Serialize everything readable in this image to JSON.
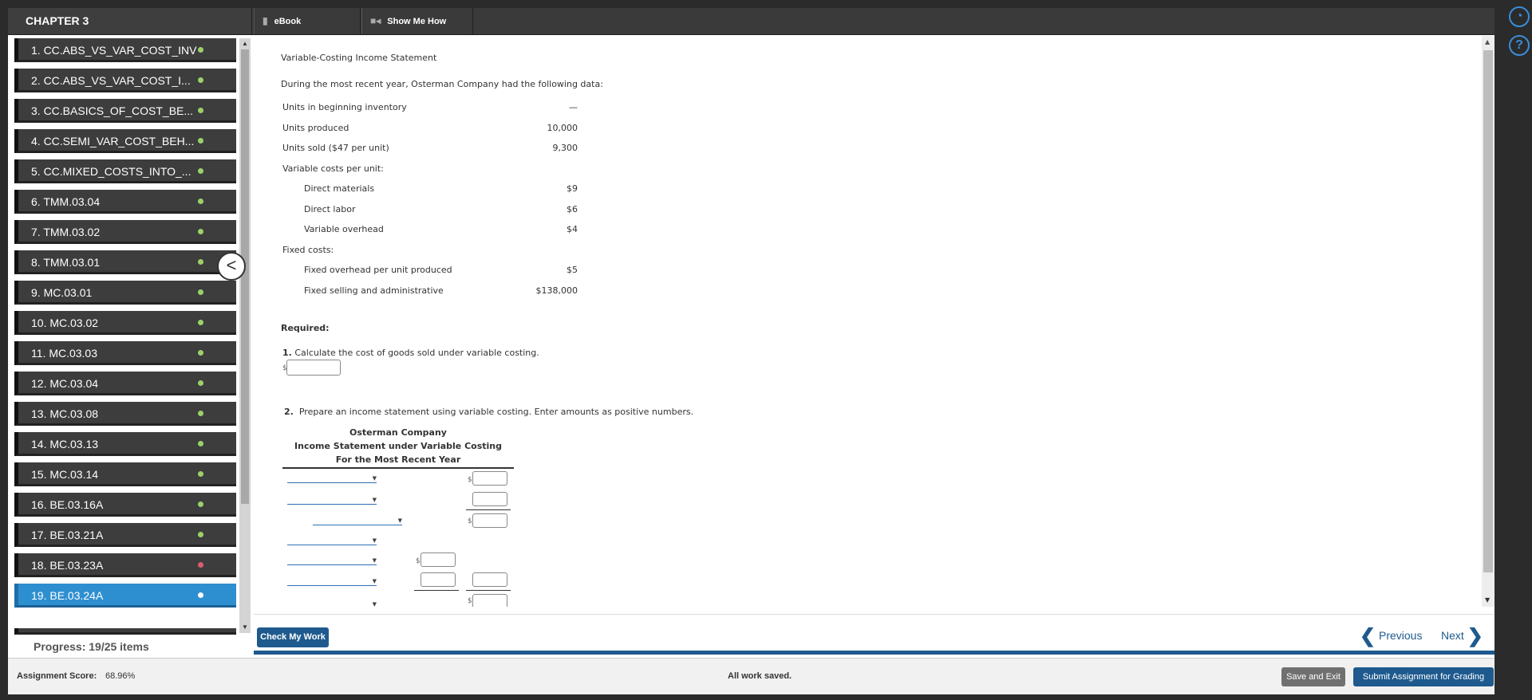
{
  "header": {
    "chapter": "CHAPTER 3",
    "tabs": [
      {
        "label": "eBook",
        "icon": "book-icon"
      },
      {
        "label": "Show Me How",
        "icon": "video-icon"
      }
    ]
  },
  "sidebar": {
    "items": [
      {
        "label": "1. CC.ABS_VS_VAR_COST_INV",
        "status": "done"
      },
      {
        "label": "2. CC.ABS_VS_VAR_COST_I...",
        "status": "done"
      },
      {
        "label": "3. CC.BASICS_OF_COST_BE...",
        "status": "done"
      },
      {
        "label": "4. CC.SEMI_VAR_COST_BEH...",
        "status": "done"
      },
      {
        "label": "5. CC.MIXED_COSTS_INTO_...",
        "status": "done"
      },
      {
        "label": "6. TMM.03.04",
        "status": "done"
      },
      {
        "label": "7. TMM.03.02",
        "status": "done"
      },
      {
        "label": "8. TMM.03.01",
        "status": "done"
      },
      {
        "label": "9. MC.03.01",
        "status": "done"
      },
      {
        "label": "10. MC.03.02",
        "status": "done"
      },
      {
        "label": "11. MC.03.03",
        "status": "done"
      },
      {
        "label": "12. MC.03.04",
        "status": "done"
      },
      {
        "label": "13. MC.03.08",
        "status": "done"
      },
      {
        "label": "14. MC.03.13",
        "status": "done"
      },
      {
        "label": "15. MC.03.14",
        "status": "done"
      },
      {
        "label": "16. BE.03.16A",
        "status": "done"
      },
      {
        "label": "17. BE.03.21A",
        "status": "done"
      },
      {
        "label": "18. BE.03.23A",
        "status": "wrong"
      },
      {
        "label": "19. BE.03.24A",
        "status": "current"
      }
    ],
    "progress": "Progress:  19/25 items"
  },
  "problem": {
    "title": "Variable-Costing Income Statement",
    "intro": "During the most recent year, Osterman Company had the following data:",
    "data": [
      {
        "label": "Units in beginning inventory",
        "value": "—",
        "indent": false
      },
      {
        "label": "Units produced",
        "value": "10,000",
        "indent": false
      },
      {
        "label": "Units sold ($47 per unit)",
        "value": "9,300",
        "indent": false
      },
      {
        "label": "Variable costs per unit:",
        "value": "",
        "indent": false
      },
      {
        "label": "Direct materials",
        "value": "$9",
        "indent": true
      },
      {
        "label": "Direct labor",
        "value": "$6",
        "indent": true
      },
      {
        "label": "Variable overhead",
        "value": "$4",
        "indent": true
      },
      {
        "label": "Fixed costs:",
        "value": "",
        "indent": false
      },
      {
        "label": "Fixed overhead per unit produced",
        "value": "$5",
        "indent": true
      },
      {
        "label": "Fixed selling and administrative",
        "value": "$138,000",
        "indent": true
      }
    ],
    "required": "Required:",
    "q1_num": "1.",
    "q1_text": "Calculate the cost of goods sold under variable costing.",
    "q2_num": "2.",
    "q2_text": "Prepare an income statement using variable costing. Enter amounts as positive numbers.",
    "statement_heading": [
      "Osterman Company",
      "Income Statement under Variable Costing",
      "For the Most Recent Year"
    ],
    "currency": "$"
  },
  "footer": {
    "check": "Check My Work",
    "previous": "Previous",
    "next": "Next",
    "score_label": "Assignment Score:",
    "score_value": "68.96%",
    "status": "All work saved.",
    "save_exit": "Save and Exit",
    "submit": "Submit Assignment for Grading"
  },
  "colors": {
    "accent": "#1e5a8e",
    "active_item": "#2e8fd0",
    "done_dot": "#9bd16a",
    "wrong_dot": "#e05a70"
  }
}
